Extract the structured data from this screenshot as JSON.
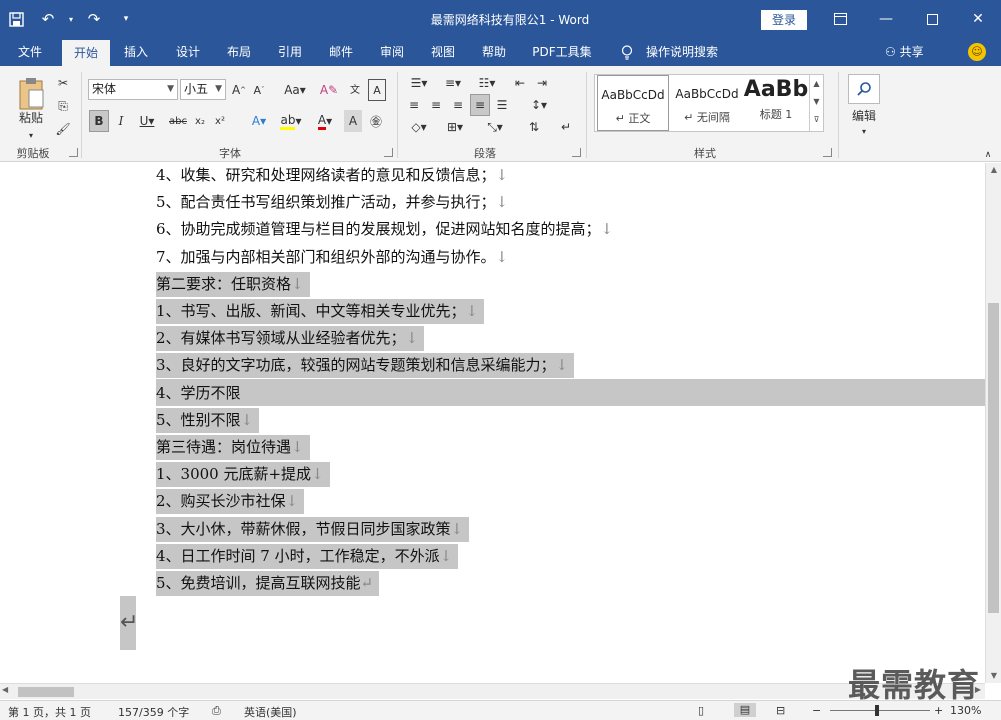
{
  "window": {
    "title": "最需网络科技有限公1  -  Word",
    "login_label": "登录"
  },
  "tabs": [
    "文件",
    "开始",
    "插入",
    "设计",
    "布局",
    "引用",
    "邮件",
    "审阅",
    "视图",
    "帮助",
    "PDF工具集",
    "操作说明搜索"
  ],
  "active_tab": "开始",
  "share_label": "共享",
  "ribbon": {
    "clipboard": {
      "paste_label": "粘贴",
      "group_label": "剪贴板"
    },
    "font": {
      "font_name": "宋体",
      "font_size": "小五",
      "group_label": "字体"
    },
    "paragraph": {
      "group_label": "段落"
    },
    "styles": {
      "group_label": "样式",
      "items": [
        {
          "sample": "AaBbCcDd",
          "name": "↵ 正文"
        },
        {
          "sample": "AaBbCcDd",
          "name": "↵ 无间隔"
        },
        {
          "sample": "AaBb",
          "name": "标题 1"
        }
      ]
    },
    "editing": {
      "label": "编辑"
    }
  },
  "document": {
    "lines": [
      {
        "text": "4、收集、研究和处理网络读者的意见和反馈信息；",
        "mark": "↓",
        "selected": false
      },
      {
        "text": "5、配合责任书写组织策划推广活动，并参与执行；",
        "mark": "↓",
        "selected": false
      },
      {
        "text": "6、协助完成频道管理与栏目的发展规划，促进网站知名度的提高；",
        "mark": "↓",
        "selected": false
      },
      {
        "text": "7、加强与内部相关部门和组织外部的沟通与协作。",
        "mark": "↓",
        "selected": false
      },
      {
        "text": "第二要求：任职资格",
        "mark": "↓",
        "selected": true
      },
      {
        "text": "1、书写、出版、新闻、中文等相关专业优先；",
        "mark": "↓",
        "selected": true
      },
      {
        "text": "2、有媒体书写领域从业经验者优先；",
        "mark": "↓",
        "selected": true
      },
      {
        "text": "3、良好的文字功底，较强的网站专题策划和信息采编能力；",
        "mark": "↓",
        "selected": true
      },
      {
        "text": "4、学历不限",
        "mark": "",
        "selected": true
      },
      {
        "text": "5、性别不限",
        "mark": "↓",
        "selected": true
      },
      {
        "text": "第三待遇：岗位待遇",
        "mark": "↓",
        "selected": true
      },
      {
        "text": "1、3000 元底薪+提成",
        "mark": "↓",
        "selected": true
      },
      {
        "text": "2、购买长沙市社保",
        "mark": "↓",
        "selected": true
      },
      {
        "text": "3、大小休，带薪休假，节假日同步国家政策",
        "mark": "↓",
        "selected": true
      },
      {
        "text": "4、日工作时间 7 小时，工作稳定，不外派",
        "mark": "↓",
        "selected": true
      },
      {
        "text": "5、免费培训，提高互联网技能",
        "mark": "↵",
        "selected": true
      }
    ]
  },
  "status": {
    "page": "第 1 页，共 1 页",
    "words": "157/359 个字",
    "language": "英语(美国)",
    "zoom": "130%"
  },
  "watermark": "最需教育"
}
